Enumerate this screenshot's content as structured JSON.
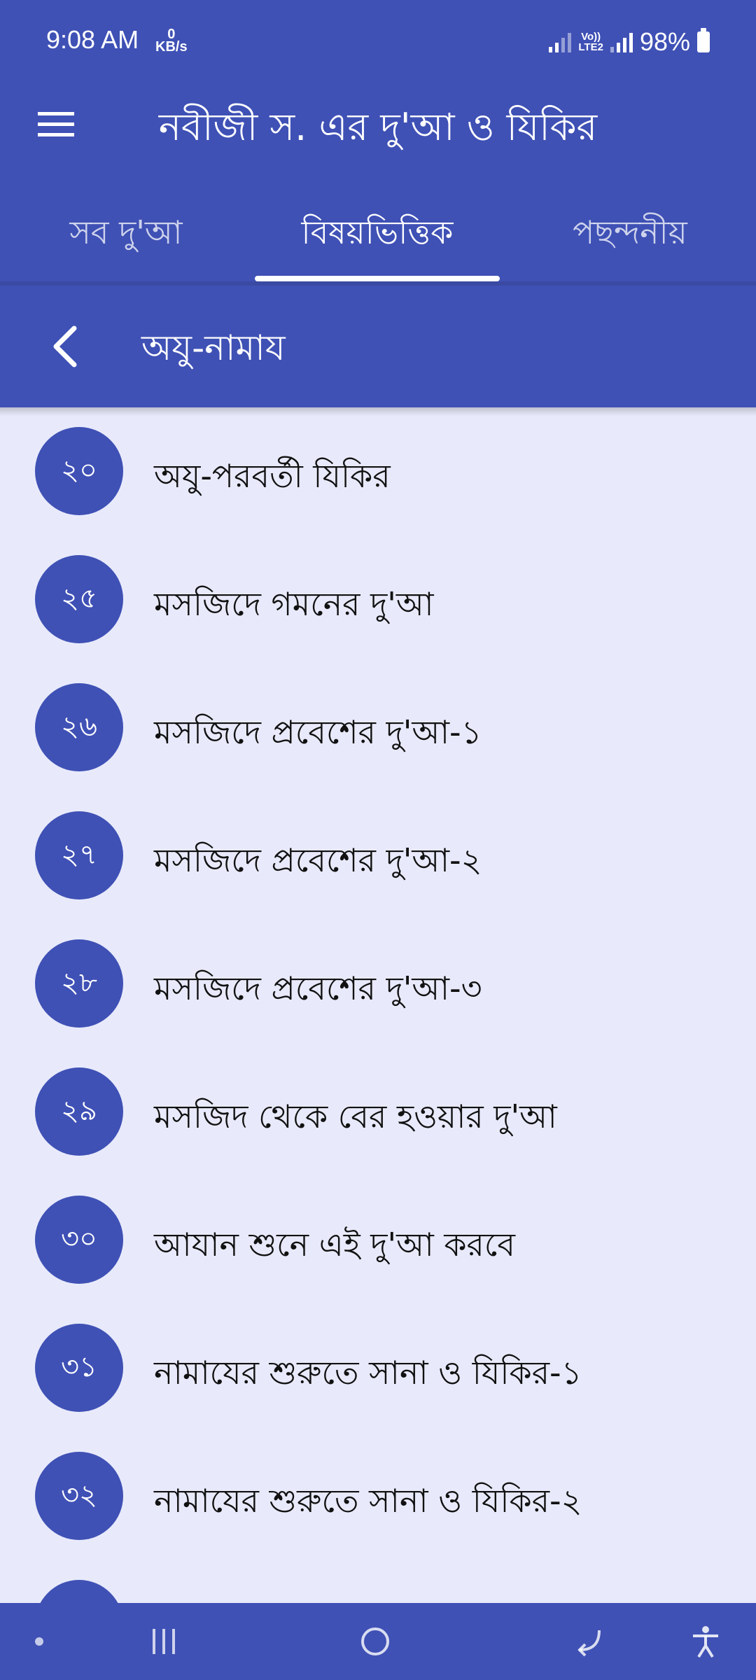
{
  "status_bar": {
    "time": "9:08 AM",
    "speed_value": "0",
    "speed_unit": "KB/s",
    "volte_top": "Vo))",
    "volte_bottom": "LTE2",
    "battery": "98%"
  },
  "app_bar": {
    "title": "নবীজী স. এর দু'আ ও যিকির",
    "menu_icon": "hamburger-menu-icon"
  },
  "tabs": [
    {
      "label": "সব দু'আ",
      "active": false
    },
    {
      "label": "বিষয়ভিত্তিক",
      "active": true
    },
    {
      "label": "পছন্দনীয়",
      "active": false
    }
  ],
  "sub_bar": {
    "title": "অযু-নামায",
    "back_icon": "chevron-left-icon"
  },
  "items": [
    {
      "number": "২০",
      "label": "অযু-পরবর্তী যিকির"
    },
    {
      "number": "২৫",
      "label": "মসজিদে গমনের দু'আ"
    },
    {
      "number": "২৬",
      "label": "মসজিদে প্রবেশের দু'আ-১"
    },
    {
      "number": "২৭",
      "label": "মসজিদে প্রবেশের দু'আ-২"
    },
    {
      "number": "২৮",
      "label": "মসজিদে প্রবেশের দু'আ-৩"
    },
    {
      "number": "২৯",
      "label": "মসজিদ থেকে বের হওয়ার দু'আ"
    },
    {
      "number": "৩০",
      "label": "আযান শুনে এই দু'আ করবে"
    },
    {
      "number": "৩১",
      "label": "নামাযের শুরুতে সানা ও যিকির-১"
    },
    {
      "number": "৩২",
      "label": "নামাযের শুরুতে সানা ও যিকির-২"
    },
    {
      "number": "",
      "label": ""
    }
  ],
  "colors": {
    "primary": "#3f51b5",
    "background": "#e8eafb",
    "text": "#111111"
  },
  "nav_bar": {
    "icons": [
      "dot-icon",
      "recent-apps-icon",
      "home-icon",
      "back-icon",
      "accessibility-icon"
    ]
  }
}
